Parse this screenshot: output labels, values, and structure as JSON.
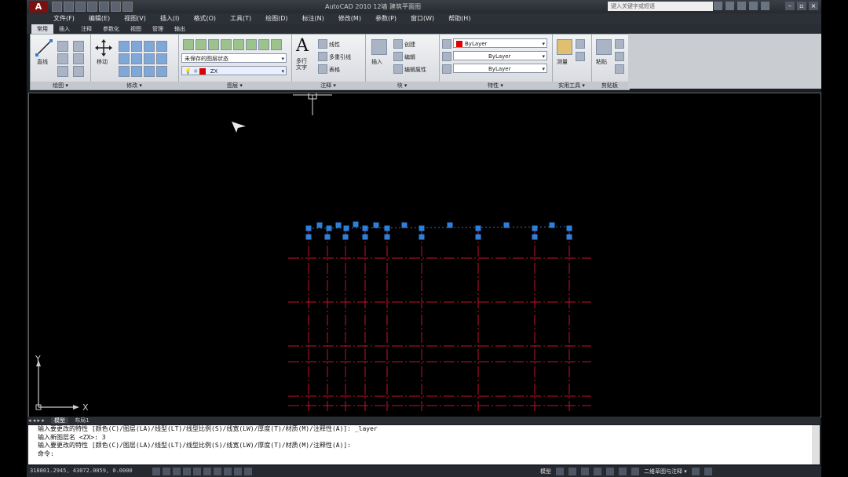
{
  "window": {
    "app_logo": "A",
    "title": "AutoCAD 2010   12墙 建筑平面图",
    "search_placeholder": "键入关键字或短语",
    "minimize": "–",
    "restore": "▫",
    "close": "×"
  },
  "menu": [
    "文件(F)",
    "编辑(E)",
    "视图(V)",
    "插入(I)",
    "格式(O)",
    "工具(T)",
    "绘图(D)",
    "标注(N)",
    "修改(M)",
    "参数(P)",
    "窗口(W)",
    "帮助(H)"
  ],
  "ribbon_tabs": [
    "常用",
    "插入",
    "注释",
    "参数化",
    "视图",
    "管理",
    "输出"
  ],
  "ribbon": {
    "draw": {
      "title": "绘图 ▾",
      "line_label": "直线"
    },
    "modify": {
      "title": "修改 ▾",
      "move_label": "移动"
    },
    "layers": {
      "title": "图层 ▾",
      "state_combo": "未保存的图层状态",
      "layer_combo": "ZX"
    },
    "annotation": {
      "title": "注释 ▾",
      "text_label": "多行\n文字",
      "dim_label": "线性",
      "leader_label": "多重引线",
      "table_label": "表格"
    },
    "block": {
      "title": "块 ▾",
      "insert_label": "插入",
      "create_label": "创建",
      "edit_label": "编辑",
      "attr_label": "编辑属性"
    },
    "properties": {
      "title": "特性 ▾",
      "color_combo": "ByLayer",
      "linetype_combo": "ByLayer",
      "lineweight_combo": "ByLayer"
    },
    "utilities": {
      "title": "实用工具 ▾",
      "measure_label": "测量"
    },
    "clipboard": {
      "title": "剪贴板",
      "paste_label": "粘贴"
    }
  },
  "ucs": {
    "x_label": "X",
    "y_label": "Y"
  },
  "model_tabs": [
    "◂ ◂ ▸ ▸",
    "模型",
    "布局1"
  ],
  "command_lines": [
    "输入要更改的特性 [颜色(C)/图层(LA)/线型(LT)/线型比例(S)/线宽(LW)/厚度(T)/材质(M)/注释性(A)]: _layer",
    "输入新图层名 <ZX>: 3",
    "输入要更改的特性 [颜色(C)/图层(LA)/线型(LT)/线型比例(S)/线宽(LW)/厚度(T)/材质(M)/注释性(A)]:",
    "命令:"
  ],
  "status": {
    "coords": "318801.2945, 43072.0059, 0.0000",
    "model_label": "模型",
    "view_label": "二维草图与注释 ▾"
  },
  "colors": {
    "grid_line": "#c8102e",
    "grip": "#2f7fd9",
    "bylayer_red": "#d00000"
  }
}
